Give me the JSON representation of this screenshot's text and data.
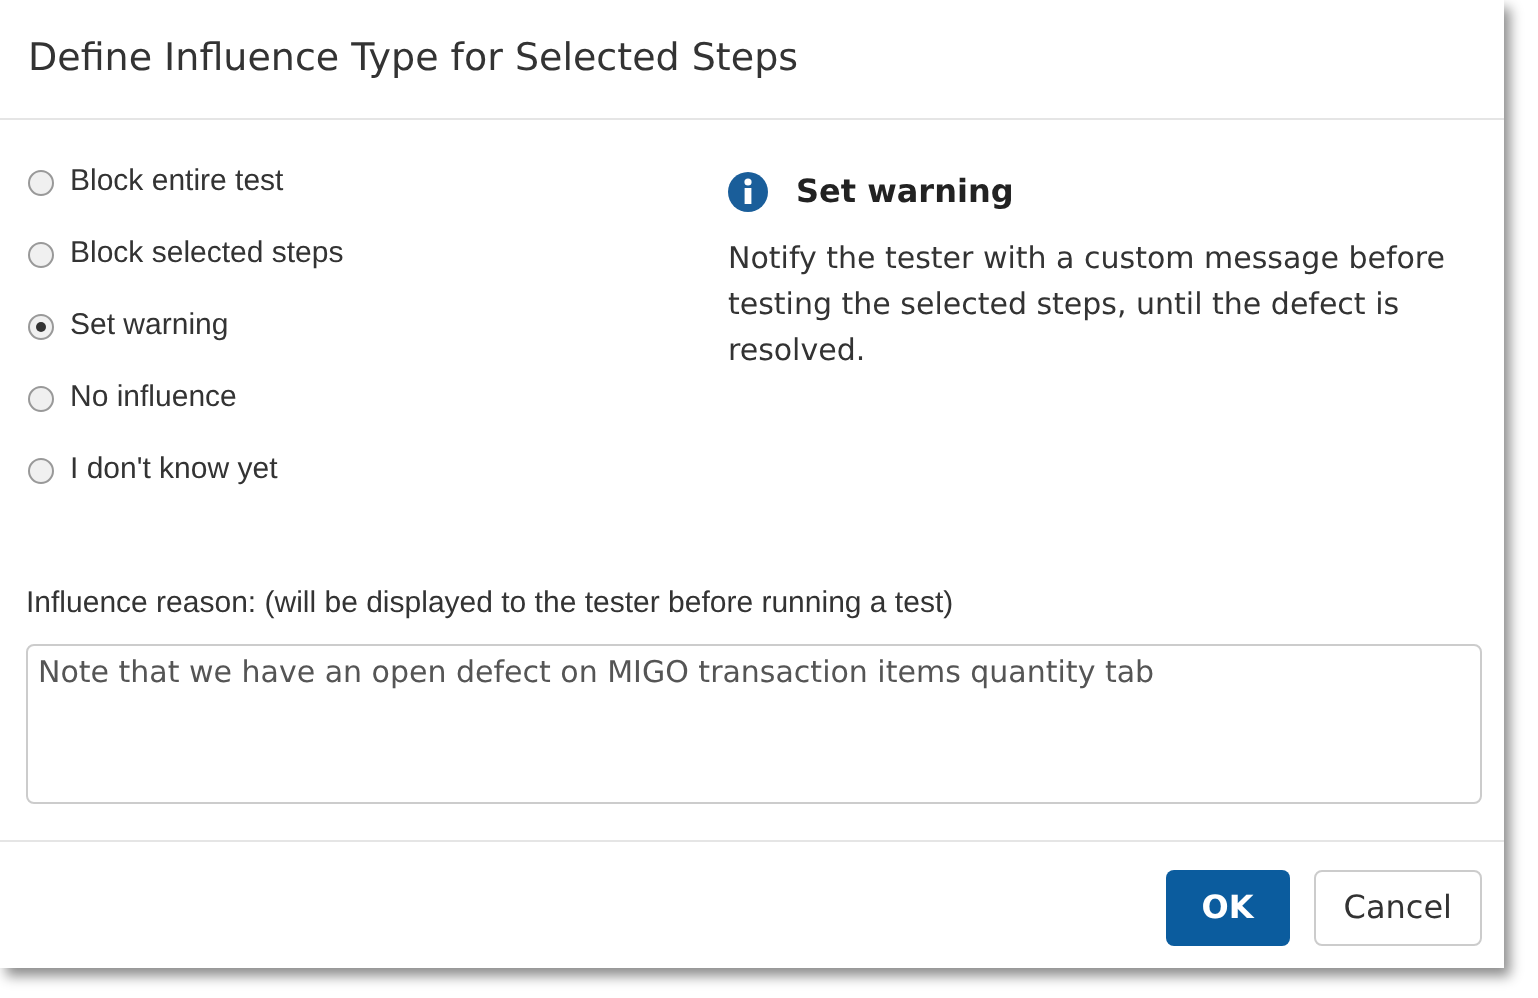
{
  "dialog": {
    "title": "Define Influence Type for Selected Steps",
    "options": [
      {
        "label": "Block entire test",
        "selected": false
      },
      {
        "label": "Block selected steps",
        "selected": false
      },
      {
        "label": "Set warning",
        "selected": true
      },
      {
        "label": "No influence",
        "selected": false
      },
      {
        "label": "I don't know yet",
        "selected": false
      }
    ],
    "info": {
      "title": "Set warning",
      "description": "Notify the tester with a custom message before testing the selected steps, until the defect is resolved."
    },
    "reason": {
      "label": "Influence reason: (will be displayed to the tester before running a test)",
      "value": "Note that we have an open defect on MIGO transaction items quantity tab"
    },
    "buttons": [
      {
        "label": "OK",
        "kind": "primary"
      },
      {
        "label": "Cancel",
        "kind": "secondary"
      }
    ]
  }
}
